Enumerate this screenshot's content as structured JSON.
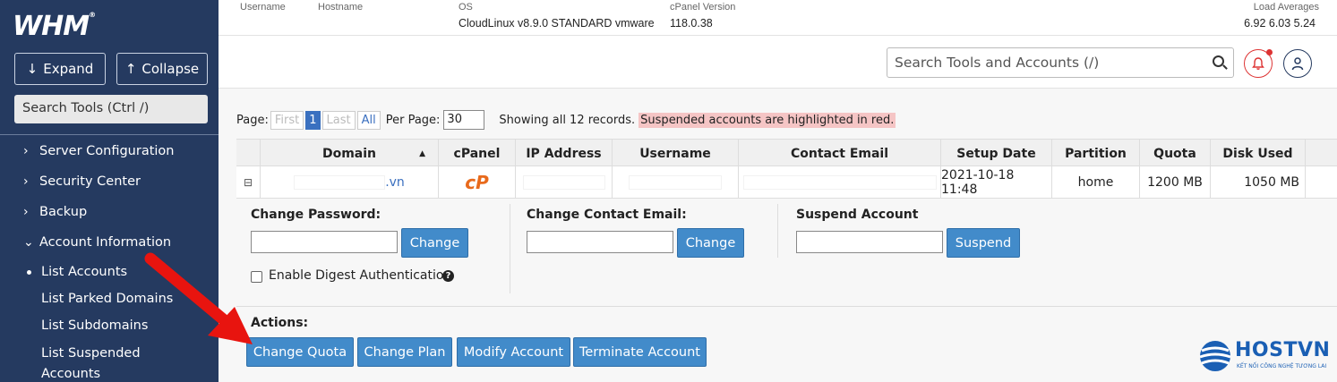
{
  "sidebar": {
    "logo": "WHM",
    "logo_reg": "®",
    "expand_label": "Expand",
    "collapse_label": "Collapse",
    "search_label": "Search Tools (Ctrl /)",
    "nav": [
      {
        "label": "Server Configuration"
      },
      {
        "label": "Security Center"
      },
      {
        "label": "Backup"
      },
      {
        "label": "Account Information"
      }
    ],
    "sub_items": [
      {
        "label": "List Accounts"
      },
      {
        "label": "List Parked Domains"
      },
      {
        "label": "List Subdomains"
      },
      {
        "label": "List Suspended"
      },
      {
        "label": "Accounts"
      }
    ]
  },
  "header": {
    "username_label": "Username",
    "hostname_label": "Hostname",
    "os_label": "OS",
    "os_value": "CloudLinux v8.9.0 STANDARD vmware",
    "cpanel_version_label": "cPanel Version",
    "cpanel_version_value": "118.0.38",
    "load_label": "Load Averages",
    "load_value": "6.92  6.03  5.24",
    "search_placeholder": "Search Tools and Accounts (/)"
  },
  "pager": {
    "page_label": "Page:",
    "first": "First",
    "current": "1",
    "last": "Last",
    "all": "All",
    "per_page_label": "Per Page:",
    "per_page_value": "30",
    "showing": "Showing all 12 records.",
    "suspended_note": "Suspended accounts are highlighted in red."
  },
  "table": {
    "columns": [
      "Domain",
      "cPanel",
      "IP Address",
      "Username",
      "Contact Email",
      "Setup Date",
      "Partition",
      "Quota",
      "Disk Used"
    ],
    "sort_indicator": "▲",
    "row": {
      "expand_icon": "⊟",
      "domain_suffix": ".vn",
      "cpanel_logo": "cP",
      "setup_date": "2021-10-18 11:48",
      "partition": "home",
      "quota": "1200 MB",
      "disk_used": "1050 MB"
    }
  },
  "panel": {
    "change_password_label": "Change Password:",
    "change_button": "Change",
    "change_email_label": "Change Contact Email:",
    "suspend_label": "Suspend Account",
    "suspend_button": "Suspend",
    "digest_label": "Enable Digest Authentication",
    "actions_label": "Actions:",
    "actions": [
      "Change Quota",
      "Change Plan",
      "Modify Account",
      "Terminate Account"
    ]
  },
  "watermark": {
    "brand": "HOSTVN",
    "tagline": "KẾT NỐI CÔNG NGHỆ TƯƠNG LAI"
  },
  "colors": {
    "sidebar_bg": "#253a60",
    "button_blue": "#428bca",
    "suspended_highlight": "#f5c5c5",
    "arrow_red": "#e8140f"
  }
}
